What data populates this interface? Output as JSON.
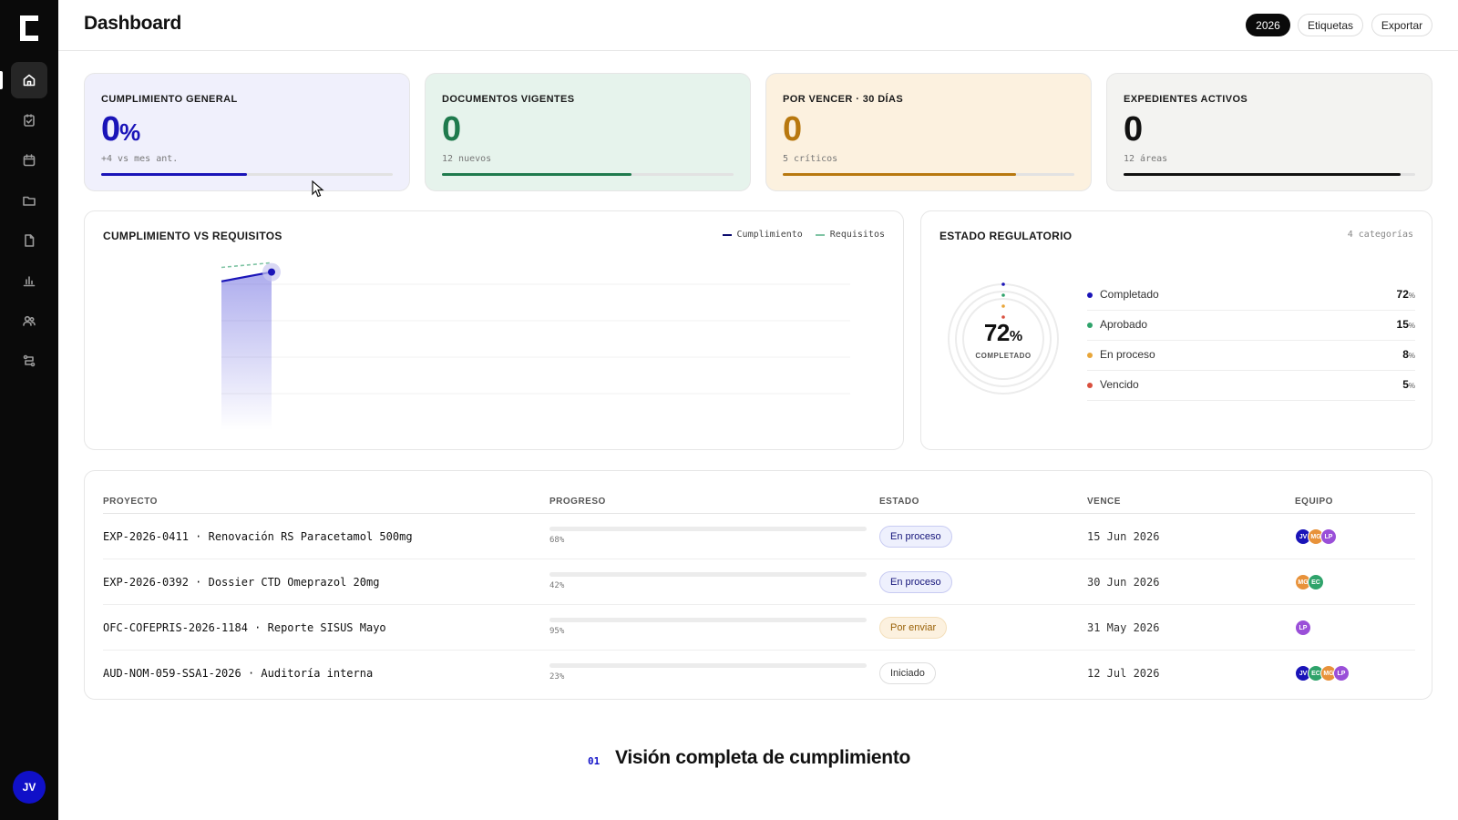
{
  "sidebar": {
    "logo": "C",
    "items": [
      {
        "name": "home-icon",
        "active": true
      },
      {
        "name": "checklist-icon",
        "active": false
      },
      {
        "name": "calendar-icon",
        "active": false
      },
      {
        "name": "folder-icon",
        "active": false
      },
      {
        "name": "document-icon",
        "active": false
      },
      {
        "name": "bar-chart-icon",
        "active": false
      },
      {
        "name": "users-icon",
        "active": false
      },
      {
        "name": "workflow-icon",
        "active": false
      }
    ],
    "user_initials": "JV"
  },
  "header": {
    "title": "Dashboard",
    "year_button": "2026",
    "tags_button": "Etiquetas",
    "export_button": "Exportar"
  },
  "kpis": [
    {
      "label": "CUMPLIMIENTO GENERAL",
      "value": "0",
      "unit": "%",
      "sub": "+4 vs mes ant.",
      "progress": 0.5,
      "color": "#1a14b8",
      "bg": "#f0f0fc"
    },
    {
      "label": "DOCUMENTOS VIGENTES",
      "value": "0",
      "unit": "",
      "sub": "12 nuevos",
      "progress": 0.65,
      "color": "#1f7a4d",
      "bg": "#e6f3ec"
    },
    {
      "label": "POR VENCER · 30 DÍAS",
      "value": "0",
      "unit": "",
      "sub": "5 críticos",
      "progress": 0.8,
      "color": "#b8780f",
      "bg": "#fcf1df"
    },
    {
      "label": "EXPEDIENTES ACTIVOS",
      "value": "0",
      "unit": "",
      "sub": "12 áreas",
      "progress": 0.95,
      "color": "#111111",
      "bg": "#f3f3f1"
    }
  ],
  "compliance_chart": {
    "title": "CUMPLIMIENTO VS REQUISITOS",
    "legend": [
      {
        "name": "Cumplimiento",
        "color": "#0b0b6e"
      },
      {
        "name": "Requisitos",
        "color": "#7fc4a4"
      }
    ]
  },
  "chart_data": {
    "type": "line",
    "title": "CUMPLIMIENTO VS REQUISITOS",
    "series": [
      {
        "name": "Cumplimiento",
        "values": [
          64,
          68
        ]
      },
      {
        "name": "Requisitos",
        "values": [
          70,
          72
        ]
      }
    ],
    "ylim": [
      0,
      100
    ],
    "grid": true,
    "legend_position": "top-right"
  },
  "regulatory": {
    "title": "ESTADO REGULATORIO",
    "meta": "4 categorías",
    "center_value": "72",
    "center_unit": "%",
    "center_label": "COMPLETADO",
    "items": [
      {
        "name": "Completado",
        "value": "72",
        "unit": "%",
        "color": "#1a14b8"
      },
      {
        "name": "Aprobado",
        "value": "15",
        "unit": "%",
        "color": "#2fa36b"
      },
      {
        "name": "En proceso",
        "value": "8",
        "unit": "%",
        "color": "#e8a63a"
      },
      {
        "name": "Vencido",
        "value": "5",
        "unit": "%",
        "color": "#d9503f"
      }
    ]
  },
  "table": {
    "headers": {
      "project": "PROYECTO",
      "progress": "PROGRESO",
      "status": "ESTADO",
      "due": "VENCE",
      "team": "EQUIPO"
    },
    "rows": [
      {
        "project": "EXP-2026-0411 · Renovación RS Paracetamol 500mg",
        "progress": 68,
        "progress_label": "68%",
        "status": "En proceso",
        "status_kind": "process",
        "due": "15 Jun 2026",
        "team": [
          "JV",
          "MG",
          "LP"
        ]
      },
      {
        "project": "EXP-2026-0392 · Dossier CTD Omeprazol 20mg",
        "progress": 42,
        "progress_label": "42%",
        "status": "En proceso",
        "status_kind": "process",
        "due": "30 Jun 2026",
        "team": [
          "MG",
          "EC"
        ]
      },
      {
        "project": "OFC-COFEPRIS-2026-1184 · Reporte SISUS Mayo",
        "progress": 95,
        "progress_label": "95%",
        "status": "Por enviar",
        "status_kind": "pending",
        "due": "31 May 2026",
        "team": [
          "LP"
        ]
      },
      {
        "project": "AUD-NOM-059-SSA1-2026 · Auditoría interna",
        "progress": 23,
        "progress_label": "23%",
        "status": "Iniciado",
        "status_kind": "started",
        "due": "12 Jul 2026",
        "team": [
          "JV",
          "EC",
          "MG",
          "LP"
        ]
      }
    ],
    "team_colors": {
      "JV": "#1a14b8",
      "MG": "#e8923a",
      "LP": "#9a4fd8",
      "EC": "#2fa36b"
    }
  },
  "footer": {
    "number": "01",
    "title": "Visión completa de cumplimiento"
  }
}
